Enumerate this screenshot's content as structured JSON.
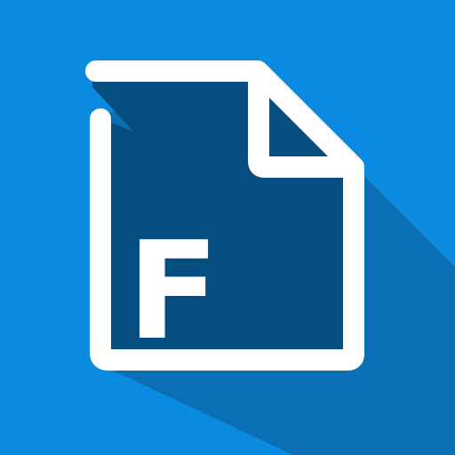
{
  "icon": {
    "name": "file-icon",
    "letter": "F",
    "colors": {
      "background": "#0a8bdf",
      "long_shadow": "#0b6fb6",
      "page_fill": "#054e7f",
      "outline": "#ffffff",
      "letter": "#ffffff"
    }
  }
}
